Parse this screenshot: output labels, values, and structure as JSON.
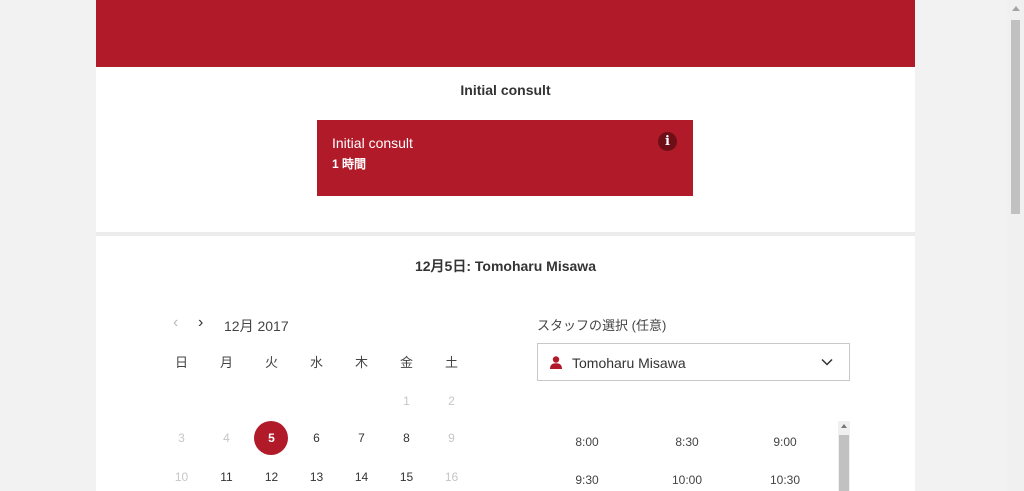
{
  "service": {
    "title": "Initial consult",
    "card_name": "Initial consult",
    "card_duration": "1 時間",
    "info_glyph": "i"
  },
  "date_heading": "12月5日: Tomoharu Misawa",
  "calendar": {
    "prev": "‹",
    "next": "›",
    "month_label": "12月 2017",
    "weekdays": [
      "日",
      "月",
      "火",
      "水",
      "木",
      "金",
      "土"
    ],
    "row1": [
      "",
      "",
      "",
      "",
      "",
      "1",
      "2"
    ],
    "row2": [
      "3",
      "4",
      "5",
      "6",
      "7",
      "8",
      "9"
    ],
    "row3": [
      "10",
      "11",
      "12",
      "13",
      "14",
      "15",
      "16"
    ],
    "selected_day": "5"
  },
  "staff": {
    "label": "スタッフの選択 (任意)",
    "selected": "Tomoharu Misawa"
  },
  "slots": [
    "8:00",
    "8:30",
    "9:00",
    "9:30",
    "10:00",
    "10:30"
  ],
  "colors": {
    "accent": "#b11a28",
    "info_icon_bg": "#6e0f18"
  },
  "icons": {
    "person": "person-icon",
    "chevron": "chevron-down-icon",
    "info": "info-icon"
  }
}
